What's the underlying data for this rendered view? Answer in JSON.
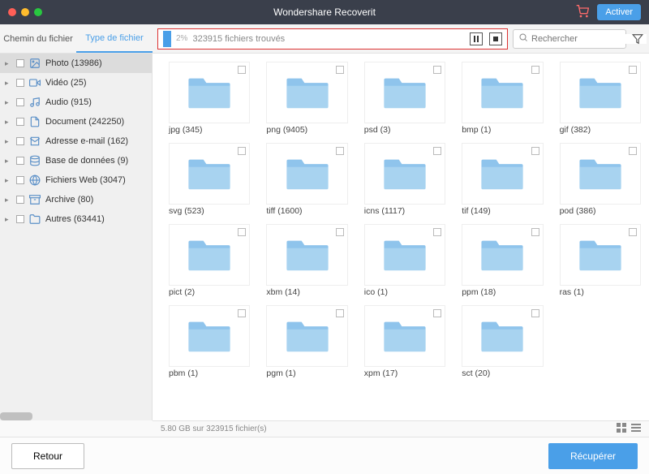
{
  "window": {
    "title": "Wondershare Recoverit",
    "activate": "Activer"
  },
  "tabs": {
    "path": "Chemin du fichier",
    "type": "Type de fichier"
  },
  "progress": {
    "percent": "2%",
    "found": "323915 fichiers trouvés"
  },
  "search": {
    "placeholder": "Rechercher"
  },
  "sidebar": {
    "items": [
      {
        "label": "Photo (13986)",
        "active": true
      },
      {
        "label": "Vidéo (25)"
      },
      {
        "label": "Audio (915)"
      },
      {
        "label": "Document (242250)"
      },
      {
        "label": "Adresse e-mail (162)"
      },
      {
        "label": "Base de données (9)"
      },
      {
        "label": "Fichiers Web (3047)"
      },
      {
        "label": "Archive (80)"
      },
      {
        "label": "Autres (63441)"
      }
    ]
  },
  "folders": [
    {
      "label": "jpg (345)"
    },
    {
      "label": "png (9405)"
    },
    {
      "label": "psd (3)"
    },
    {
      "label": "bmp (1)"
    },
    {
      "label": "gif (382)"
    },
    {
      "label": "svg (523)"
    },
    {
      "label": "tiff (1600)"
    },
    {
      "label": "icns (1117)"
    },
    {
      "label": "tif (149)"
    },
    {
      "label": "pod (386)"
    },
    {
      "label": "pict (2)"
    },
    {
      "label": "xbm (14)"
    },
    {
      "label": "ico (1)"
    },
    {
      "label": "ppm (18)"
    },
    {
      "label": "ras (1)"
    },
    {
      "label": "pbm (1)"
    },
    {
      "label": "pgm (1)"
    },
    {
      "label": "xpm (17)"
    },
    {
      "label": "sct (20)"
    }
  ],
  "status": {
    "text": "5.80 GB sur 323915 fichier(s)"
  },
  "footer": {
    "back": "Retour",
    "recover": "Récupérer"
  }
}
